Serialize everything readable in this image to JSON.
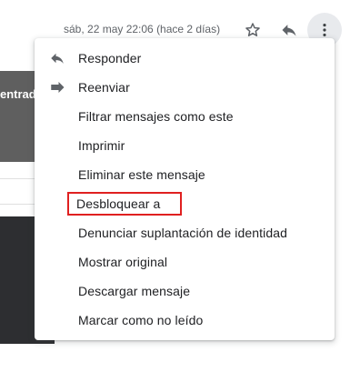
{
  "header": {
    "date": "sáb, 22 may 22:06 (hace 2 días)",
    "icons": {
      "star": "star-icon",
      "reply": "reply-icon",
      "more": "more-vertical-icon"
    }
  },
  "background": {
    "fragment_text": "entrad"
  },
  "menu": {
    "items": [
      {
        "label": "Responder",
        "icon": "reply-icon"
      },
      {
        "label": "Reenviar",
        "icon": "forward-icon"
      },
      {
        "label": "Filtrar mensajes como este"
      },
      {
        "label": "Imprimir"
      },
      {
        "label": "Eliminar este mensaje"
      },
      {
        "label": "Desbloquear a",
        "highlighted": true
      },
      {
        "label": "Denunciar suplantación de identidad"
      },
      {
        "label": "Mostrar original"
      },
      {
        "label": "Descargar mensaje"
      },
      {
        "label": "Marcar como no leído"
      }
    ]
  },
  "colors": {
    "highlight_outline": "#e02020",
    "icon_gray": "#5f6368",
    "text": "#202124",
    "active_button_bg": "#e8eaed"
  }
}
